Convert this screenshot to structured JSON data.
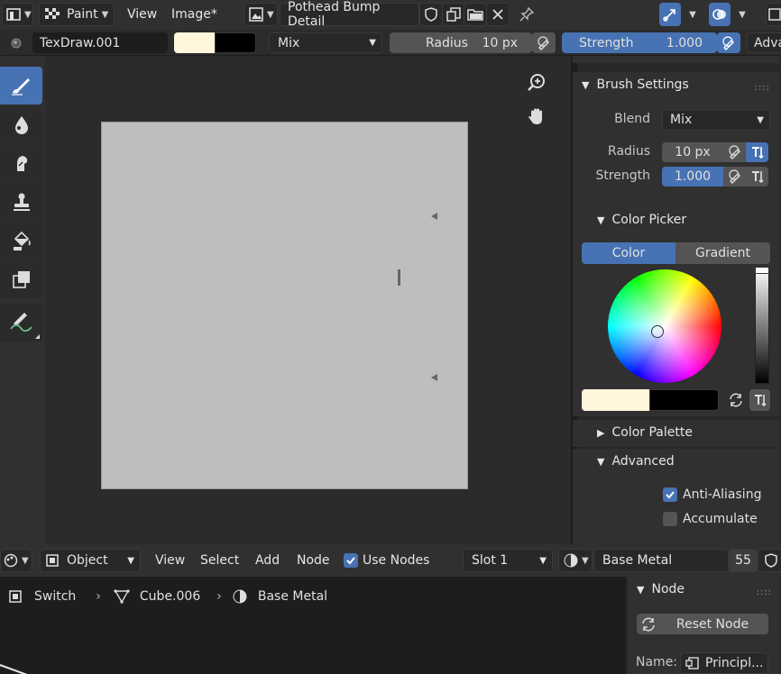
{
  "header": {
    "mode_label": "Paint",
    "menu_view": "View",
    "menu_image": "Image*",
    "image_name": "Pothead Bump Detail"
  },
  "tool_settings": {
    "brush_name": "TexDraw.001",
    "blend_mode": "Mix",
    "radius_label": "Radius",
    "radius_value": "10 px",
    "strength_label": "Strength",
    "strength_value": "1.000",
    "advanced_label": "Adva",
    "primary_color": "#fff6dc",
    "secondary_color": "#000000"
  },
  "sidebar": {
    "brush_settings": {
      "title": "Brush Settings",
      "blend_label": "Blend",
      "blend_value": "Mix",
      "radius_label": "Radius",
      "radius_value": "10 px",
      "strength_label": "Strength",
      "strength_value": "1.000"
    },
    "color_picker": {
      "title": "Color Picker",
      "tab_color": "Color",
      "tab_gradient": "Gradient",
      "primary_color": "#fff6dc",
      "secondary_color": "#000000"
    },
    "color_palette": {
      "title": "Color Palette"
    },
    "advanced": {
      "title": "Advanced",
      "anti_aliasing_label": "Anti-Aliasing",
      "anti_aliasing_checked": true,
      "accumulate_label": "Accumulate",
      "accumulate_checked": false
    }
  },
  "node_header": {
    "object_mode": "Object",
    "menu_view": "View",
    "menu_select": "Select",
    "menu_add": "Add",
    "menu_node": "Node",
    "use_nodes_label": "Use Nodes",
    "use_nodes_checked": true,
    "slot": "Slot 1",
    "material_name": "Base Metal",
    "user_count": "55"
  },
  "breadcrumb": {
    "item1": "Switch",
    "item2": "Cube.006",
    "item3": "Base Metal"
  },
  "node_panel": {
    "title": "Node",
    "reset_label": "Reset Node",
    "name_label": "Name:",
    "name_value": "Principl..."
  },
  "colors": {
    "accent": "#4772b3",
    "panel": "#303030",
    "canvas": "#bebebe"
  }
}
